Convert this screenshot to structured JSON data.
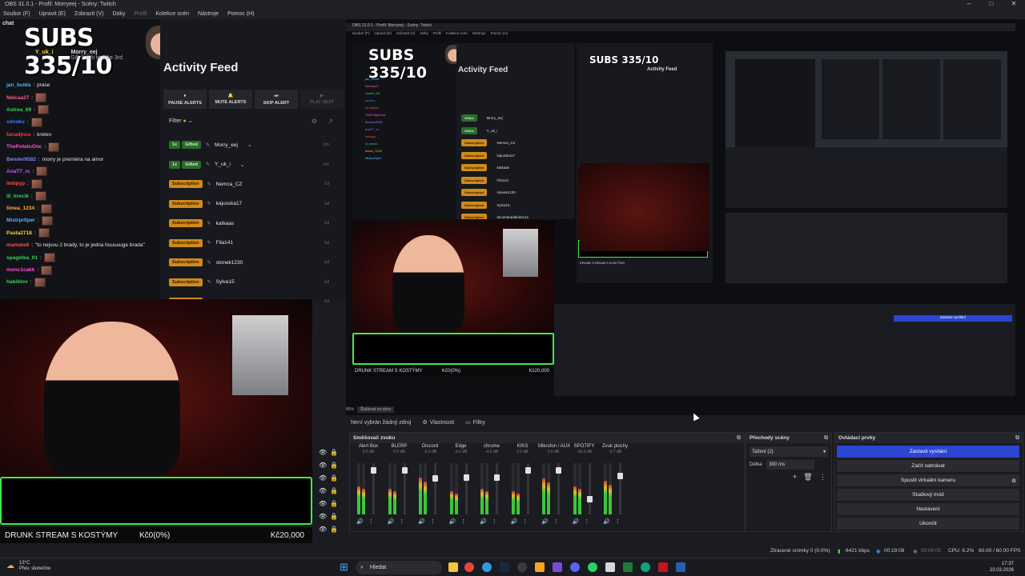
{
  "window": {
    "title": "OBS 31.0.1 - Profil: Morryeej - Scény: Twitch"
  },
  "menu": [
    "Soubor (F)",
    "Upravit (E)",
    "Zobrazit (V)",
    "Doky",
    "Profil",
    "Kolekce scén",
    "Nástroje",
    "Pomoc (H)"
  ],
  "chat": {
    "title": "chat",
    "subs_overlay": "SUBS 335/10",
    "gifter_name": "Y_uk_i",
    "gift_user": "Morry_eej",
    "gift_text": "Gift 1 sub to take 3rd",
    "lines": [
      {
        "user": "jan_bulda",
        "msg": "prase",
        "color": "#4fb6ff"
      },
      {
        "user": "Nelcaa27",
        "msg": "",
        "color": "#ff5a8a"
      },
      {
        "user": "Astrea_69",
        "msg": "",
        "color": "#35d35b"
      },
      {
        "user": "sdvoku",
        "msg": "",
        "color": "#3d7bff"
      },
      {
        "user": "fanadjnce",
        "msg": "kreten",
        "color": "#ff3c3c"
      },
      {
        "user": "ThePotatoOnc",
        "msg": "",
        "color": "#ff4fd8"
      },
      {
        "user": "Bender9582",
        "msg": "morry je premiéra na amor",
        "color": "#7f7fff"
      },
      {
        "user": "AnaT7_rc",
        "msg": "",
        "color": "#c45bff"
      },
      {
        "user": "lmbpyp",
        "msg": "",
        "color": "#ff4a4a"
      },
      {
        "user": "lil_krecik",
        "msg": "",
        "color": "#35d35b"
      },
      {
        "user": "timea_1234",
        "msg": "",
        "color": "#ffb02e"
      },
      {
        "user": "Mistrpr0per",
        "msg": "",
        "color": "#4fb6ff"
      },
      {
        "user": "Pasta2718",
        "msg": "",
        "color": "#ffd12e"
      },
      {
        "user": "mamate8",
        "msg": "\"to nejsou 2 brady, to je jedna huuuuuge brada\"",
        "color": "#ff4a4a"
      },
      {
        "user": "spagetka_01",
        "msg": "",
        "color": "#35d35b"
      },
      {
        "user": "monc1cakk",
        "msg": "",
        "color": "#ff4fd8"
      },
      {
        "user": "habiblov",
        "msg": "",
        "color": "#35d35b"
      }
    ]
  },
  "feed": {
    "title": "Activity Feed",
    "buttons": [
      "PAUSE ALERTS",
      "MUTE ALERTS",
      "SKIP ALERT",
      "PLAY NEXT"
    ],
    "filter": "Filter",
    "items": [
      {
        "count": "1x",
        "type": "Gifted",
        "name": "Morry_eej",
        "time": "1m"
      },
      {
        "count": "1x",
        "type": "Gifted",
        "name": "Y_uk_i",
        "time": "1m"
      },
      {
        "count": "",
        "type": "Subscription",
        "name": "Nemca_CZ",
        "time": "1d"
      },
      {
        "count": "",
        "type": "Subscription",
        "name": "kajusska17",
        "time": "1d"
      },
      {
        "count": "",
        "type": "Subscription",
        "name": "katkaas",
        "time": "1d"
      },
      {
        "count": "",
        "type": "Subscription",
        "name": "Fila141",
        "time": "1d"
      },
      {
        "count": "",
        "type": "Subscription",
        "name": "stonek1230",
        "time": "1d"
      },
      {
        "count": "",
        "type": "Subscription",
        "name": "Sylva15",
        "time": "1d"
      },
      {
        "count": "",
        "type": "Subscription",
        "name": "tacomaradakobru11",
        "time": "1d"
      }
    ]
  },
  "stream_bar": {
    "title": "DRUNK STREAM S KOSTÝMY",
    "progress": "Kč0(0%)",
    "goal": "Kč20,000"
  },
  "preview": {
    "zoom": "85%",
    "zoom_select": "Škálovat na okno"
  },
  "props_bar": {
    "no_source": "Není vybrán žádný zdroj",
    "properties": "Vlastnosti",
    "filters": "Filtry"
  },
  "mixer": {
    "title": "Směšovač zvuku",
    "channels": [
      {
        "name": "Alert Box",
        "db": "0.0 dB",
        "level": 0.55,
        "vol": 0.85
      },
      {
        "name": "BLERP",
        "db": "0.0 dB",
        "level": 0.5,
        "vol": 0.85
      },
      {
        "name": "Discord",
        "db": "-5.3 dB",
        "level": 0.72,
        "vol": 0.7
      },
      {
        "name": "Edge",
        "db": "-4.2 dB",
        "level": 0.45,
        "vol": 0.72
      },
      {
        "name": "chrome",
        "db": "-4.2 dB",
        "level": 0.5,
        "vol": 0.72
      },
      {
        "name": "KIKS",
        "db": "0.0 dB",
        "level": 0.45,
        "vol": 0.85
      },
      {
        "name": "Mikrofon / AUX",
        "db": "0.0 dB",
        "level": 0.7,
        "vol": 0.85
      },
      {
        "name": "SPOTIFY",
        "db": "-29.3 dB",
        "level": 0.55,
        "vol": 0.3
      },
      {
        "name": "Zvuk plochy",
        "db": "-3.7 dB",
        "level": 0.65,
        "vol": 0.75
      }
    ]
  },
  "transitions": {
    "title": "Přechody scény",
    "selected": "Tažení (2)",
    "duration_label": "Délka",
    "duration": "300 ms"
  },
  "controls": {
    "title": "Ovládací prvky",
    "buttons": [
      "Zastavit vysílání",
      "Začít nahrávat",
      "Spustit virtuální kameru",
      "Studiový mód",
      "Nastavení",
      "Ukončit"
    ]
  },
  "status": {
    "dropped": "Ztracené snímky 0 (0.0%)",
    "kbps": "6421 kbps",
    "live": "00:19:08",
    "rec": "00:00:00",
    "cpu": "CPU: 6.2%",
    "fps": "60.00 / 60.00 FPS"
  },
  "taskbar": {
    "temp": "13°C",
    "weather": "Přev. slunečno",
    "search": "Hledat",
    "time": "17:37",
    "date": "23.03.2026"
  },
  "colors": {
    "accent": "#2b46d1",
    "green_border": "#43e84a",
    "subscription": "#d18a1a",
    "gifted": "#2d6b2c"
  }
}
